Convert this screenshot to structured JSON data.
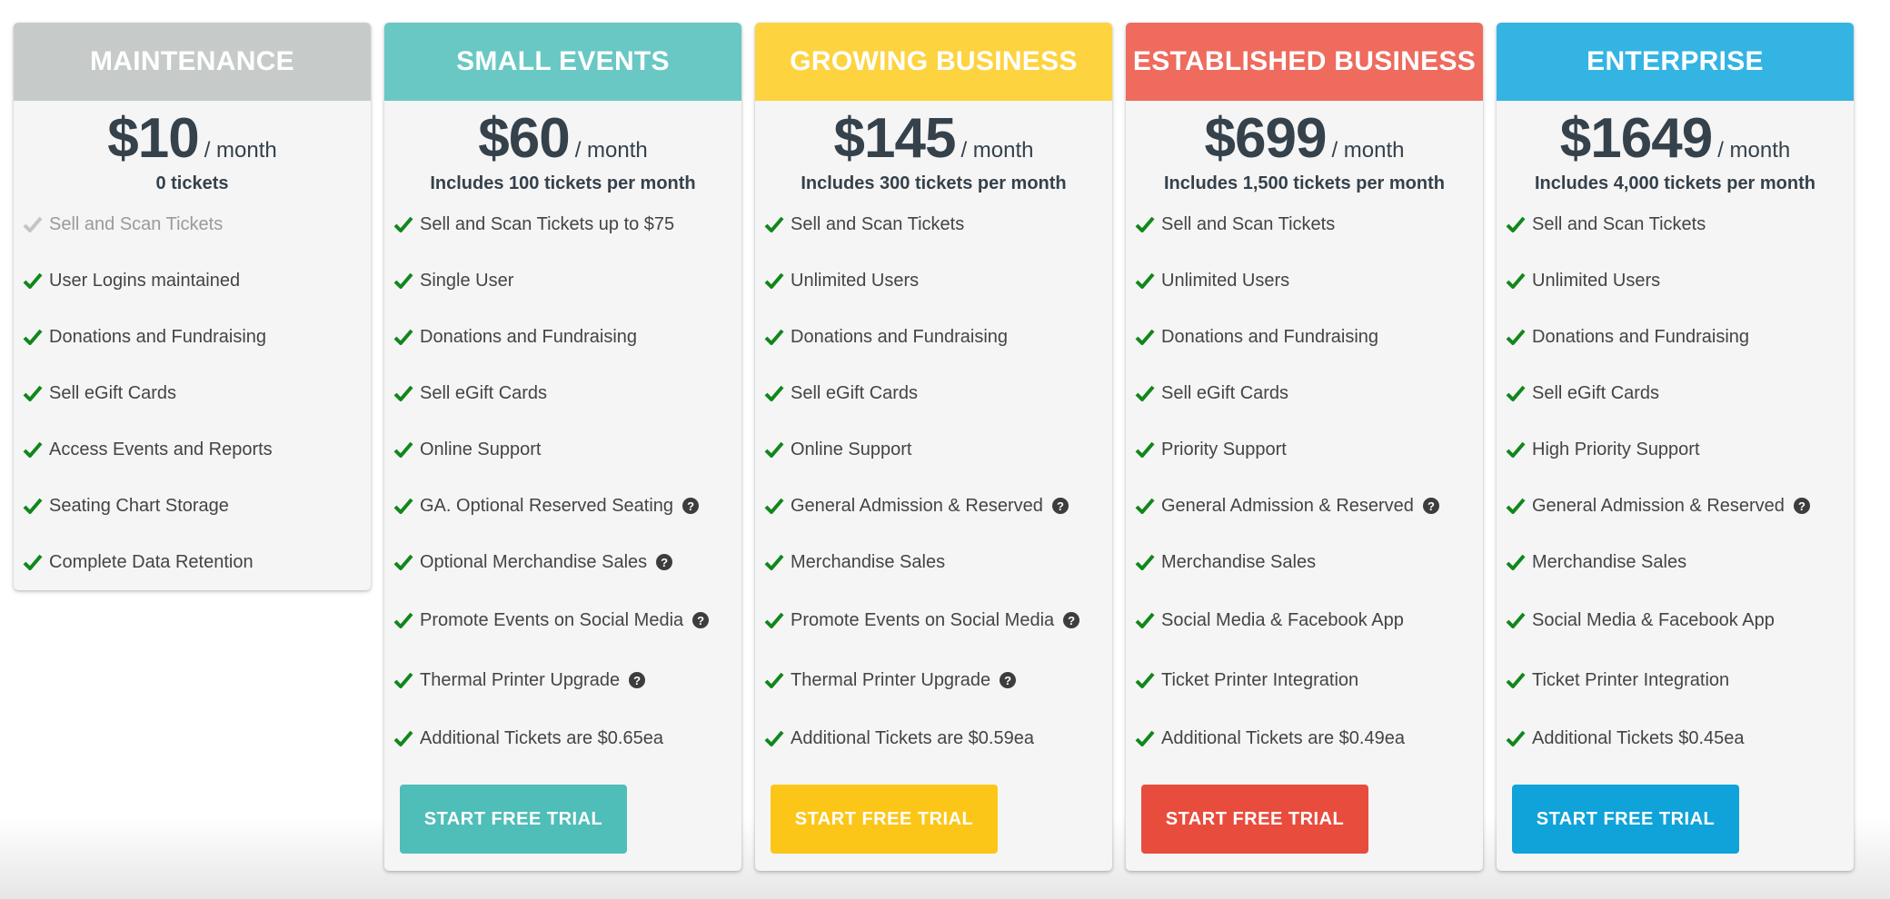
{
  "colors": {
    "maintenance": "#c6cbca",
    "small_events": "#69c8c4",
    "growing_business": "#fed340",
    "established_business": "#ee6b5e",
    "enterprise": "#34b4e3",
    "check_green": "#11871b",
    "check_muted": "#c4c4c4",
    "btn_small_events": "#4fbdb8",
    "btn_growing_business": "#fcc619",
    "btn_established_business": "#e84c3d",
    "btn_enterprise": "#0fa3d9"
  },
  "icons": {
    "check": "checkmark-icon",
    "help": "question-circle-icon"
  },
  "plans": [
    {
      "name": "MAINTENANCE",
      "price": "$10",
      "period": "/ month",
      "subtitle": "0 tickets",
      "features": [
        "Sell and Scan Tickets",
        "User Logins maintained",
        "Donations and Fundraising",
        "Sell eGift Cards",
        "Access Events and Reports",
        "Seating Chart Storage",
        "Complete Data Retention"
      ]
    },
    {
      "name": "SMALL EVENTS",
      "price": "$60",
      "period": "/ month",
      "subtitle": "Includes 100 tickets per month",
      "features": [
        "Sell and Scan Tickets up to $75",
        "Single User",
        "Donations and Fundraising",
        "Sell eGift Cards",
        "Online Support",
        "GA. Optional Reserved Seating",
        "Optional Merchandise Sales",
        "Promote Events on Social Media",
        "Thermal Printer Upgrade",
        "Additional Tickets are $0.65ea"
      ],
      "button": "START FREE TRIAL"
    },
    {
      "name": "GROWING BUSINESS",
      "price": "$145",
      "period": "/ month",
      "subtitle": "Includes 300 tickets per month",
      "features": [
        "Sell and Scan Tickets",
        "Unlimited Users",
        "Donations and Fundraising",
        "Sell eGift Cards",
        "Online Support",
        "General Admission & Reserved",
        "Merchandise Sales",
        "Promote Events on Social Media",
        "Thermal Printer Upgrade",
        "Additional Tickets are $0.59ea"
      ],
      "button": "START FREE TRIAL"
    },
    {
      "name": "ESTABLISHED BUSINESS",
      "price": "$699",
      "period": "/ month",
      "subtitle": "Includes 1,500 tickets per month",
      "features": [
        "Sell and Scan Tickets",
        "Unlimited Users",
        "Donations and Fundraising",
        "Sell eGift Cards",
        "Priority Support",
        "General Admission & Reserved",
        "Merchandise Sales",
        "Social Media & Facebook App",
        "Ticket Printer Integration",
        "Additional Tickets are $0.49ea"
      ],
      "button": "START FREE TRIAL"
    },
    {
      "name": "ENTERPRISE",
      "price": "$1649",
      "period": "/ month",
      "subtitle": "Includes 4,000 tickets per month",
      "features": [
        "Sell and Scan Tickets",
        "Unlimited Users",
        "Donations and Fundraising",
        "Sell eGift Cards",
        "High Priority Support",
        "General Admission & Reserved",
        "Merchandise Sales",
        "Social Media & Facebook App",
        "Ticket Printer Integration",
        "Additional Tickets $0.45ea"
      ],
      "button": "START FREE TRIAL"
    }
  ]
}
